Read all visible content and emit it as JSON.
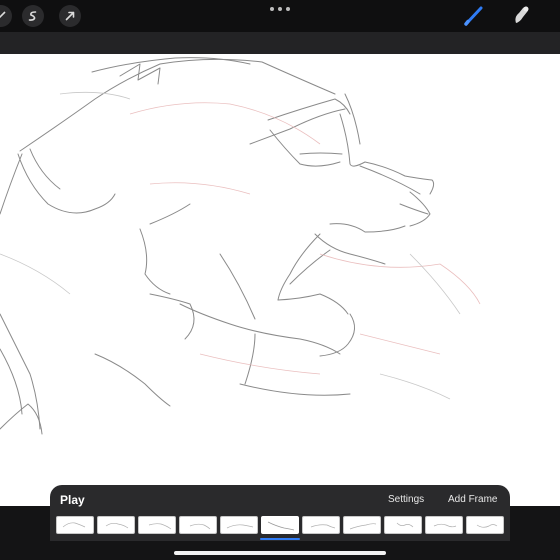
{
  "toolbar": {
    "left_tools": [
      "modify-icon",
      "selection-icon",
      "transform-icon"
    ],
    "more_icon": "more-dots-icon",
    "right_tools": [
      "brush-icon",
      "smudge-icon"
    ],
    "accent_color": "#2f7cf6"
  },
  "canvas": {
    "content": "sketch-drawing",
    "background": "#ffffff"
  },
  "animation_assist": {
    "play_label": "Play",
    "settings_label": "Settings",
    "add_frame_label": "Add Frame",
    "frame_count": 11,
    "active_frame_index": 5
  }
}
